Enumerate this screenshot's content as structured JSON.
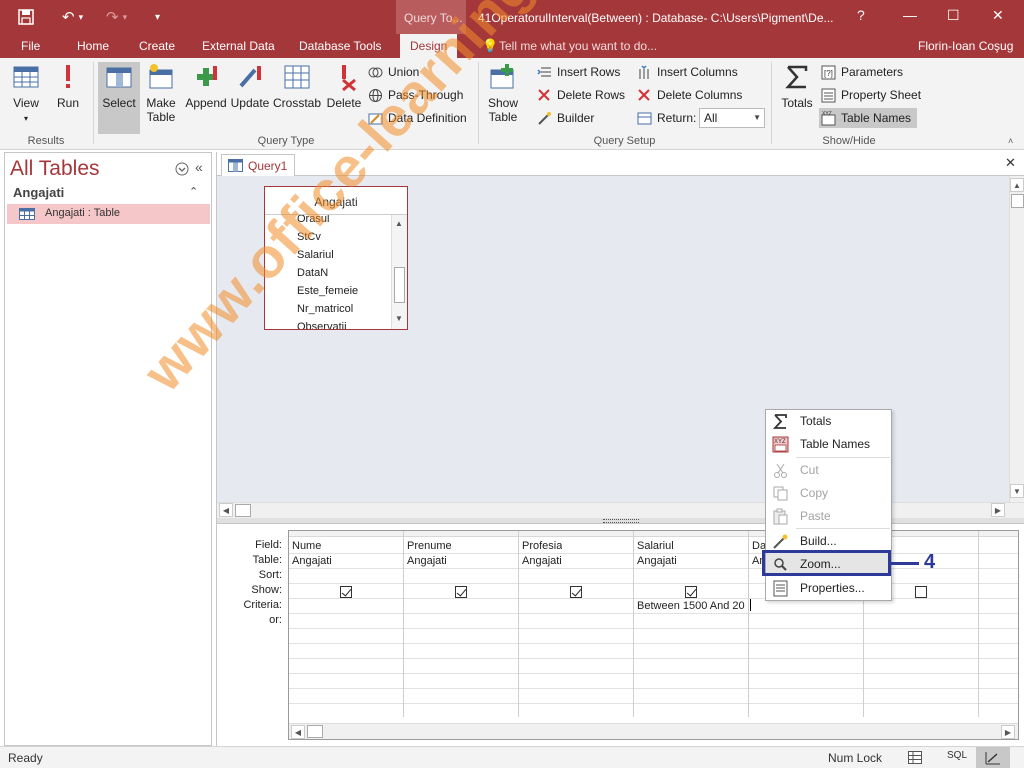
{
  "window": {
    "title": "41OperatorulInterval(Between) : Database- C:\\Users\\Pigment\\De...",
    "contextual_tab": "Query To...",
    "help": "?",
    "min": "—",
    "max": "☐",
    "close": "✕"
  },
  "tabs": [
    "File",
    "Home",
    "Create",
    "External Data",
    "Database Tools",
    "Design"
  ],
  "active_tab": "Design",
  "tell_me": "Tell me what you want to do...",
  "user": "Florin-Ioan Coşug",
  "ribbon": {
    "results": {
      "label": "Results",
      "view": "View",
      "run": "Run"
    },
    "query_type": {
      "label": "Query Type",
      "select": "Select",
      "make_table_1": "Make",
      "make_table_2": "Table",
      "append": "Append",
      "update": "Update",
      "crosstab": "Crosstab",
      "delete": "Delete",
      "union": "Union",
      "pass_through": "Pass-Through",
      "data_definition": "Data Definition"
    },
    "query_setup": {
      "label": "Query Setup",
      "show_table_1": "Show",
      "show_table_2": "Table",
      "insert_rows": "Insert Rows",
      "delete_rows": "Delete Rows",
      "builder": "Builder",
      "insert_columns": "Insert Columns",
      "delete_columns": "Delete Columns",
      "return_label": "Return:",
      "return_value": "All"
    },
    "show_hide": {
      "label": "Show/Hide",
      "totals": "Totals",
      "parameters": "Parameters",
      "property_sheet": "Property Sheet",
      "table_names": "Table Names"
    }
  },
  "nav": {
    "title": "All Tables",
    "group": "Angajati",
    "item": "Angajati : Table"
  },
  "doc_tab": "Query1",
  "table_box": {
    "name": "Angajati",
    "fields": [
      "Orasul",
      "StCv",
      "Salariul",
      "DataN",
      "Este_femeie",
      "Nr_matricol",
      "Observatii"
    ]
  },
  "grid": {
    "row_labels": [
      "Field:",
      "Table:",
      "Sort:",
      "Show:",
      "Criteria:",
      "or:"
    ],
    "columns": [
      {
        "field": "Nume",
        "table": "Angajati",
        "criteria": ""
      },
      {
        "field": "Prenume",
        "table": "Angajati",
        "criteria": ""
      },
      {
        "field": "Profesia",
        "table": "Angajati",
        "criteria": ""
      },
      {
        "field": "Salariul",
        "table": "Angajati",
        "criteria": "Between 1500 And 20"
      },
      {
        "field": "Da",
        "table": "An",
        "criteria": ""
      }
    ]
  },
  "context_menu": {
    "totals": "Totals",
    "table_names": "Table Names",
    "cut": "Cut",
    "copy": "Copy",
    "paste": "Paste",
    "build": "Build...",
    "zoom": "Zoom...",
    "properties": "Properties..."
  },
  "callout": "4",
  "status": {
    "ready": "Ready",
    "num_lock": "Num Lock",
    "sql": "SQL"
  },
  "watermark": "www.office-learning.ro",
  "colors": {
    "accent": "#a4373a",
    "callout": "#2e3a9a",
    "watermark": "#f28c28"
  }
}
